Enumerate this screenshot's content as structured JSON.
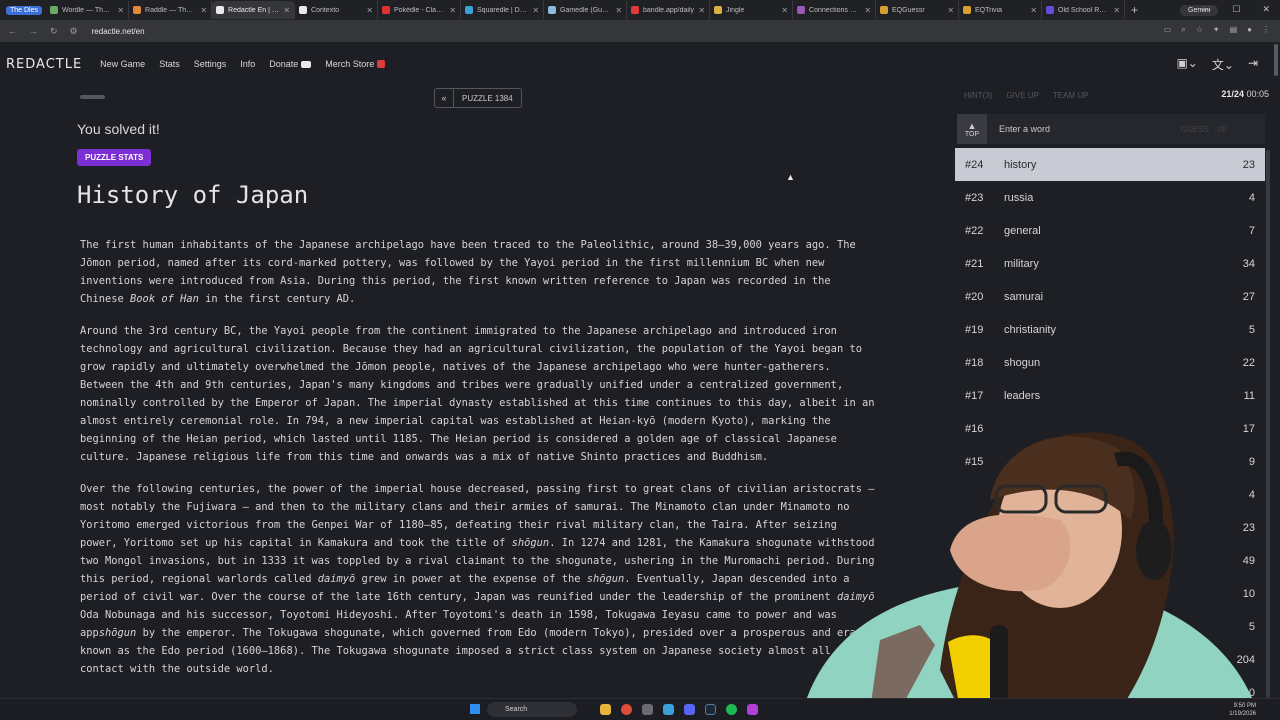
{
  "browser": {
    "tab_group": "The Dles",
    "tabs": [
      {
        "label": "Wordle — The N",
        "color": "#6aaa64"
      },
      {
        "label": "Raddle — The W",
        "color": "#e0873a"
      },
      {
        "label": "Redactle En | Wi",
        "color": "#e8e8ea",
        "active": true
      },
      {
        "label": "Contexto",
        "color": "#e8e8ea"
      },
      {
        "label": "Pokédle - Classic",
        "color": "#d33"
      },
      {
        "label": "Squaredle | Daily",
        "color": "#3aa0d8"
      },
      {
        "label": "Gamedle (Guess",
        "color": "#8bd"
      },
      {
        "label": "bandle.app/daily",
        "color": "#e03a3a"
      },
      {
        "label": "Jingle",
        "color": "#d8b040"
      },
      {
        "label": "Connections — T",
        "color": "#9b59b6"
      },
      {
        "label": "EQGuessr",
        "color": "#d8a030"
      },
      {
        "label": "EQTrivia",
        "color": "#d8a030"
      },
      {
        "label": "Old School Rune",
        "color": "#6a4ad8"
      }
    ],
    "gemini_label": "Gemini",
    "url": "redactle.net/en"
  },
  "site": {
    "logo": "REDACTLE",
    "nav": [
      "New Game",
      "Stats",
      "Settings",
      "Info",
      "Donate",
      "Merch Store"
    ]
  },
  "puzzle": {
    "prev_symbol": "«",
    "label": "PUZZLE 1384",
    "solved_text": "You solved it!",
    "stats_button": "PUZZLE STATS",
    "progress": 0.05
  },
  "article": {
    "title": "History of Japan",
    "paragraphs": [
      [
        {
          "t": "The first human inhabitants of the Japanese archipelago have been traced to the Paleolithic, around 38–39,000 years ago. The Jōmon period, named after its cord-marked pottery, was followed by the Yayoi period in the first millennium BC when new inventions were introduced from Asia. During this period, the first known written reference to Japan was recorded in the Chinese "
        },
        {
          "t": "Book of Han",
          "i": true
        },
        {
          "t": " in the first century AD."
        }
      ],
      [
        {
          "t": "Around the 3rd century BC, the Yayoi people from the continent immigrated to the Japanese archipelago and introduced iron technology and agricultural civilization. Because they had an agricultural civilization, the population of the Yayoi began to grow rapidly and ultimately overwhelmed the Jōmon people, natives of the Japanese archipelago who were hunter-gatherers. Between the 4th and 9th centuries, Japan's many kingdoms and tribes were gradually unified under a centralized government, nominally controlled by the Emperor of Japan. The imperial dynasty established at this time continues to this day, albeit in an almost entirely ceremonial role. In 794, a new imperial capital was established at Heian-kyō (modern Kyoto), marking the beginning of the Heian period, which lasted until 1185. The Heian period is considered a golden age of classical Japanese culture. Japanese religious life from this time and onwards was a mix of native Shinto practices and Buddhism."
        }
      ],
      [
        {
          "t": "Over the following centuries, the power of the imperial house decreased, passing first to great clans of civilian aristocrats – most notably the Fujiwara – and then to the military clans and their armies of samurai. The Minamoto clan under Minamoto no Yoritomo emerged victorious from the Genpei War of 1180–85, defeating their rival military clan, the Taira. After seizing power, Yoritomo set up his capital in Kamakura and took the title of "
        },
        {
          "t": "shōgun",
          "i": true
        },
        {
          "t": ". In 1274 and 1281, the Kamakura shogunate withstood two Mongol invasions, but in 1333 it was toppled by a rival claimant to the shogunate, ushering in the Muromachi period. During this period, regional warlords called "
        },
        {
          "t": "daimyō",
          "i": true
        },
        {
          "t": " grew in power at the expense of the "
        },
        {
          "t": "shōgun",
          "i": true
        },
        {
          "t": ". Eventually, Japan descended into a period of civil war. Over the course of the late 16th century, Japan was reunified under the leadership of the prominent "
        },
        {
          "t": "daimyō",
          "i": true
        },
        {
          "t": " Oda Nobunaga and his successor, Toyotomi Hideyoshi. After Toyotomi's death in 1598, Tokugawa Ieyasu came to power and was app"
        },
        {
          "t": "shōgun",
          "i": true
        },
        {
          "t": " by the emperor. The Tokugawa shogunate, which governed from Edo (modern Tokyo), presided over a prosperous and era known as the Edo period (1600–1868). The Tokugawa shogunate imposed a strict class system on Japanese society almost all contact with the outside world."
        }
      ]
    ]
  },
  "panel": {
    "hint_buttons": [
      "HINT(3)",
      "GIVE UP",
      "TEAM UP"
    ],
    "counter_found": "21/24",
    "timer": "00:05",
    "top_label": "TOP",
    "guess_placeholder": "Enter a word",
    "guess_button": "GUESS",
    "guess_hint": "(0)",
    "guesses": [
      {
        "num": "#24",
        "word": "history",
        "count": "23",
        "selected": true
      },
      {
        "num": "#23",
        "word": "russia",
        "count": "4"
      },
      {
        "num": "#22",
        "word": "general",
        "count": "7"
      },
      {
        "num": "#21",
        "word": "military",
        "count": "34"
      },
      {
        "num": "#20",
        "word": "samurai",
        "count": "27"
      },
      {
        "num": "#19",
        "word": "christianity",
        "count": "5"
      },
      {
        "num": "#18",
        "word": "shogun",
        "count": "22"
      },
      {
        "num": "#17",
        "word": "leaders",
        "count": "11"
      },
      {
        "num": "#16",
        "word": "",
        "count": "17"
      },
      {
        "num": "#15",
        "word": "",
        "count": "9"
      },
      {
        "num": "",
        "word": "",
        "count": "4"
      },
      {
        "num": "",
        "word": "",
        "count": "23"
      },
      {
        "num": "",
        "word": "",
        "count": "49"
      },
      {
        "num": "",
        "word": "",
        "count": "10"
      },
      {
        "num": "",
        "word": "",
        "count": "5"
      },
      {
        "num": "",
        "word": "",
        "count": "204"
      },
      {
        "num": "",
        "word": "",
        "count": "0"
      }
    ]
  },
  "taskbar": {
    "search": "Search",
    "time": "9:50 PM",
    "date": "1/19/2026"
  },
  "colors": {
    "accent_purple": "#7b2fd4",
    "page_bg": "#1e1f24",
    "selected_row": "#c8cbd3"
  }
}
